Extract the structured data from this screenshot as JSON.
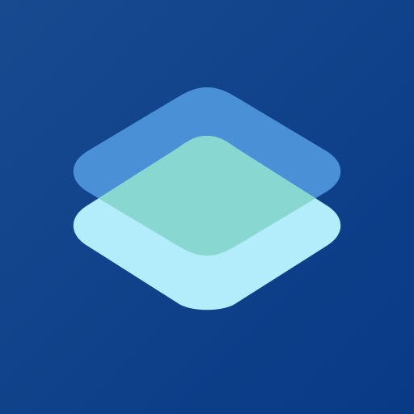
{
  "app_icon": {
    "name": "layers-icon",
    "colors": {
      "background_top_left": "#174a8f",
      "background_bottom_right": "#083a86",
      "back_layer": "#4a90d6",
      "front_layer": "#b3ecfb",
      "overlap": "#88d7d1"
    }
  }
}
